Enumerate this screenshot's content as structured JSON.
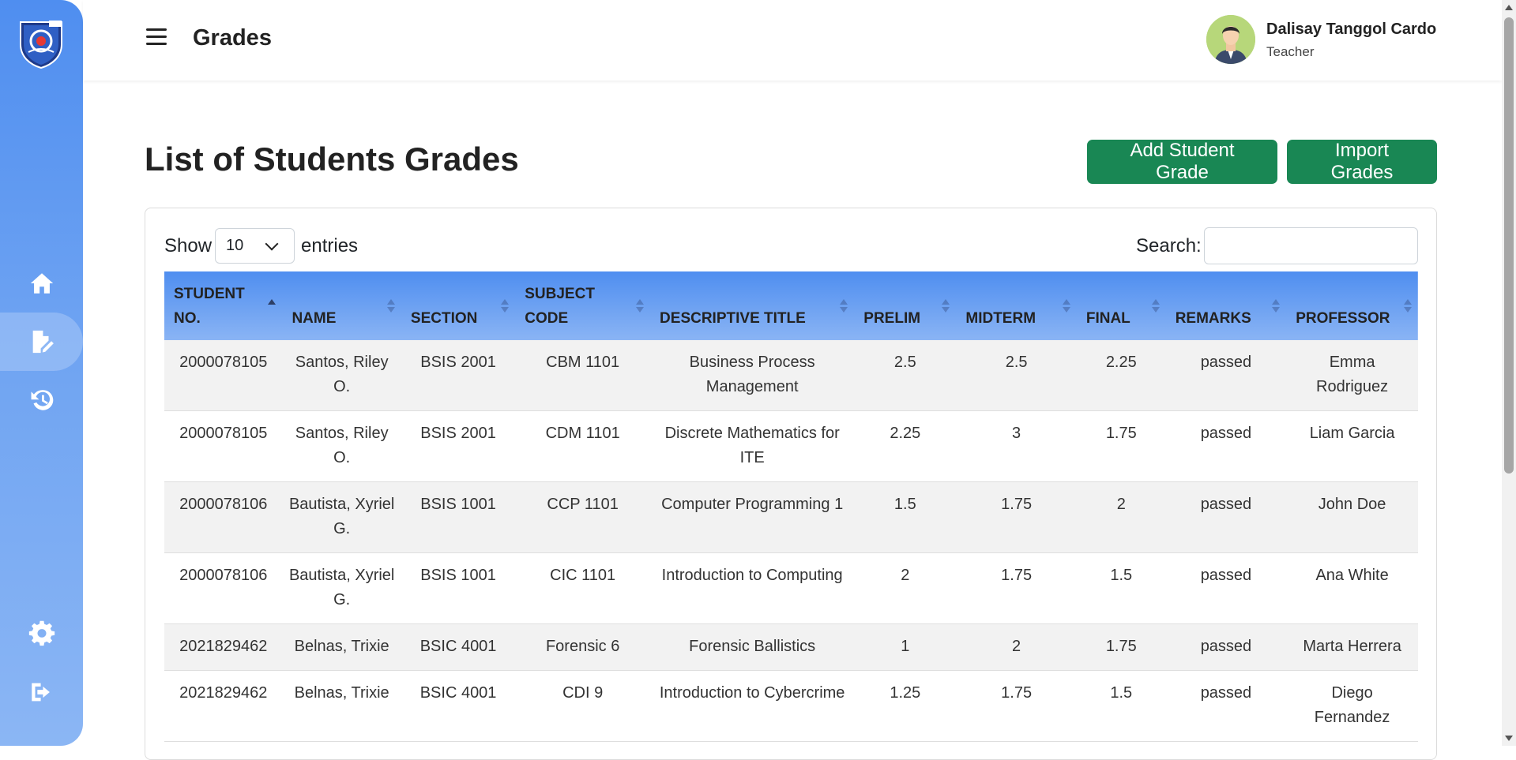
{
  "header": {
    "title": "Grades",
    "user_name": "Dalisay Tanggol Cardo",
    "user_role": "Teacher"
  },
  "sidebar": {
    "items": [
      {
        "name": "home",
        "icon": "home-icon"
      },
      {
        "name": "grades",
        "icon": "edit-document-icon",
        "active": true
      },
      {
        "name": "history",
        "icon": "history-icon"
      },
      {
        "name": "settings",
        "icon": "gear-icon"
      },
      {
        "name": "logout",
        "icon": "logout-icon"
      }
    ]
  },
  "main": {
    "heading": "List of Students Grades",
    "add_button": "Add Student Grade",
    "import_button": "Import Grades",
    "show_label": "Show",
    "entries_value": "10",
    "entries_label": "entries",
    "search_label": "Search:",
    "search_value": ""
  },
  "table": {
    "columns": [
      "STUDENT NO.",
      "NAME",
      "SECTION",
      "SUBJECT CODE",
      "DESCRIPTIVE TITLE",
      "PRELIM",
      "MIDTERM",
      "FINAL",
      "REMARKS",
      "PROFESSOR"
    ],
    "rows": [
      [
        "2000078105",
        "Santos, Riley O.",
        "BSIS 2001",
        "CBM 1101",
        "Business Process Management",
        "2.5",
        "2.5",
        "2.25",
        "passed",
        "Emma Rodriguez"
      ],
      [
        "2000078105",
        "Santos, Riley O.",
        "BSIS 2001",
        "CDM 1101",
        "Discrete Mathematics for ITE",
        "2.25",
        "3",
        "1.75",
        "passed",
        "Liam Garcia"
      ],
      [
        "2000078106",
        "Bautista, Xyriel G.",
        "BSIS 1001",
        "CCP 1101",
        "Computer Programming 1",
        "1.5",
        "1.75",
        "2",
        "passed",
        "John Doe"
      ],
      [
        "2000078106",
        "Bautista, Xyriel G.",
        "BSIS 1001",
        "CIC 1101",
        "Introduction to Computing",
        "2",
        "1.75",
        "1.5",
        "passed",
        "Ana White"
      ],
      [
        "2021829462",
        "Belnas, Trixie",
        "BSIC 4001",
        "Forensic 6",
        "Forensic Ballistics",
        "1",
        "2",
        "1.75",
        "passed",
        "Marta Herrera"
      ],
      [
        "2021829462",
        "Belnas, Trixie",
        "BSIC 4001",
        "CDI 9",
        "Introduction to Cybercrime",
        "1.25",
        "1.75",
        "1.5",
        "passed",
        "Diego Fernandez"
      ]
    ]
  },
  "colors": {
    "sidebar_top": "#4f8ef0",
    "sidebar_bottom": "#8bb6f4",
    "button_green": "#198754",
    "table_header": "#4f8ef0"
  }
}
